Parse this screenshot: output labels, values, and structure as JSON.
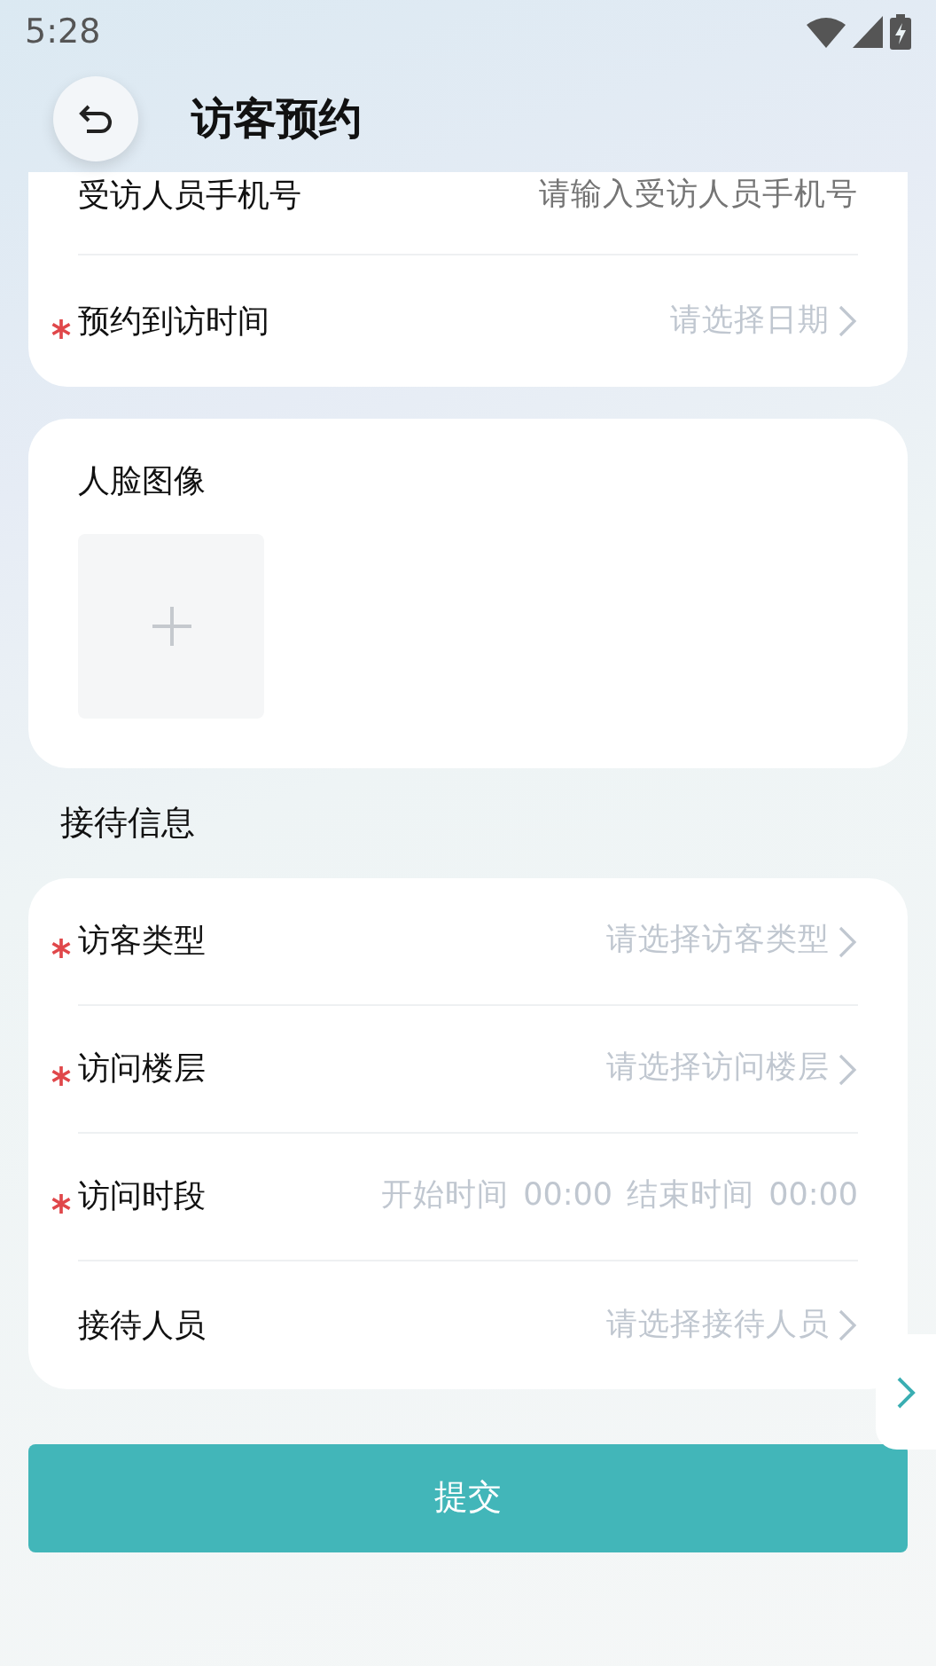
{
  "status_bar": {
    "time": "5:28"
  },
  "header": {
    "title": "访客预约"
  },
  "visit_card": {
    "rows": [
      {
        "kind": "input",
        "label": "受访人员手机号",
        "required": false,
        "placeholder": "请输入受访人员手机号"
      },
      {
        "kind": "select",
        "label": "预约到访时间",
        "required": true,
        "placeholder": "请选择日期"
      }
    ]
  },
  "face_card": {
    "label": "人脸图像"
  },
  "reception": {
    "title": "接待信息",
    "rows": [
      {
        "kind": "select",
        "label": "访客类型",
        "required": true,
        "placeholder": "请选择访客类型"
      },
      {
        "kind": "select",
        "label": "访问楼层",
        "required": true,
        "placeholder": "请选择访问楼层"
      },
      {
        "kind": "time_range",
        "label": "访问时段",
        "required": true,
        "start_label": "开始时间",
        "start_value": "00:00",
        "end_label": "结束时间",
        "end_value": "00:00"
      },
      {
        "kind": "select",
        "label": "接待人员",
        "required": false,
        "placeholder": "请选择接待人员"
      }
    ]
  },
  "submit": {
    "label": "提交"
  }
}
